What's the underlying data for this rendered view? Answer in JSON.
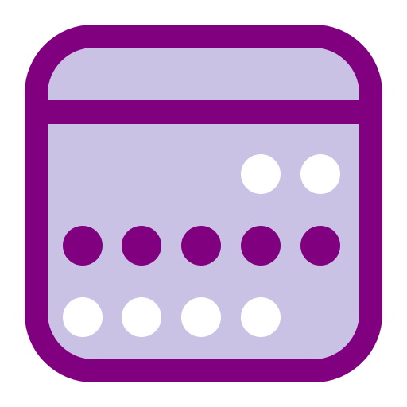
{
  "icon": {
    "name": "calendar-icon",
    "colors": {
      "frame": "#800080",
      "fill": "#c9c2e5",
      "dot_active": "#800080",
      "dot_inactive": "#ffffff",
      "background": "#ffffff"
    },
    "rows": [
      {
        "dots": [
          null,
          null,
          null,
          "inactive",
          "inactive"
        ]
      },
      {
        "dots": [
          "active",
          "active",
          "active",
          "active",
          "active"
        ]
      },
      {
        "dots": [
          "inactive",
          "inactive",
          "inactive",
          "inactive",
          null
        ]
      }
    ]
  }
}
